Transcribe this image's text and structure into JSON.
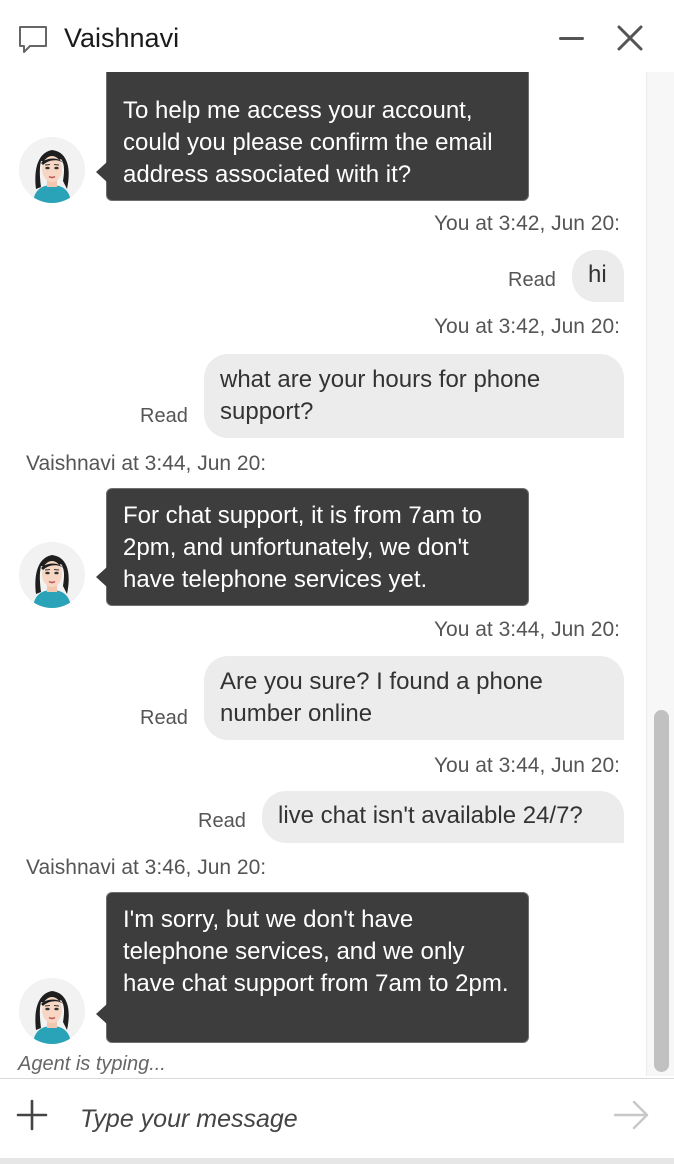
{
  "header": {
    "title": "Vaishnavi",
    "icons": {
      "chat": "chat-bubble-icon",
      "minimize": "minimize-icon",
      "close": "close-icon"
    }
  },
  "messages": [
    {
      "sender": "agent",
      "text": "To help me access your account, could you please confirm the email address associated with it?"
    },
    {
      "sender": "user",
      "timestamp": "You at 3:42, Jun 20:",
      "text": "hi",
      "status": "Read"
    },
    {
      "sender": "user",
      "timestamp": "You at 3:42, Jun 20:",
      "text": "what are your hours for phone support?",
      "status": "Read"
    },
    {
      "sender": "agent",
      "timestamp": "Vaishnavi at 3:44, Jun 20:",
      "text": "For chat support, it is from 7am to 2pm, and unfortunately, we don't have telephone services yet."
    },
    {
      "sender": "user",
      "timestamp": "You at 3:44, Jun 20:",
      "text": "Are you sure? I found a phone number online",
      "status": "Read"
    },
    {
      "sender": "user",
      "timestamp": "You at 3:44, Jun 20:",
      "text": "live chat isn't available 24/7?",
      "status": "Read"
    },
    {
      "sender": "agent",
      "timestamp": "Vaishnavi at 3:46, Jun 20:",
      "text": "I'm sorry, but we don't have telephone services, and we only have chat support from 7am to 2pm."
    }
  ],
  "typing_indicator": "Agent is typing...",
  "composer": {
    "placeholder": "Type your message",
    "icons": {
      "add": "plus-icon",
      "send": "send-arrow-icon"
    }
  },
  "colors": {
    "agent_bubble": "#3d3d3d",
    "user_bubble": "#ececec",
    "avatar_accent": "#2aa3b8"
  }
}
